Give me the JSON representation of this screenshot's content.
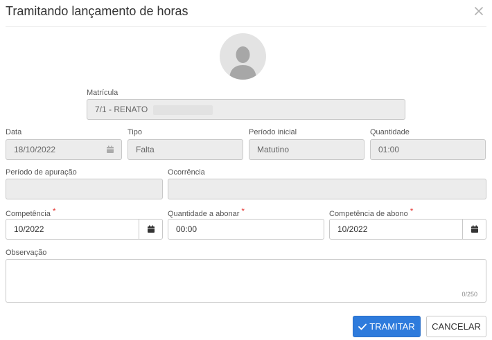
{
  "dialog": {
    "title": "Tramitando lançamento de horas"
  },
  "matricula": {
    "label": "Matrícula",
    "value": "7/1 - RENATO"
  },
  "data": {
    "label": "Data",
    "value": "18/10/2022"
  },
  "tipo": {
    "label": "Tipo",
    "value": "Falta"
  },
  "periodo_inicial": {
    "label": "Período inicial",
    "value": "Matutino"
  },
  "quantidade": {
    "label": "Quantidade",
    "value": "01:00"
  },
  "periodo_apuracao": {
    "label": "Período de apuração",
    "value": ""
  },
  "ocorrencia": {
    "label": "Ocorrência",
    "value": ""
  },
  "competencia": {
    "label": "Competência",
    "required_mark": "*",
    "value": "10/2022"
  },
  "quantidade_abonar": {
    "label": "Quantidade a abonar",
    "required_mark": "*",
    "value": "00:00"
  },
  "competencia_abono": {
    "label": "Competência de abono",
    "required_mark": "*",
    "value": "10/2022"
  },
  "observacao": {
    "label": "Observação",
    "value": "",
    "counter": "0/250"
  },
  "buttons": {
    "tramitar": "TRAMITAR",
    "cancelar": "CANCELAR"
  },
  "colors": {
    "primary": "#2e7bdc",
    "required": "#e53935",
    "readonly_bg": "#ececec"
  },
  "icons": {
    "close": "close-icon",
    "calendar": "calendar-icon",
    "check": "check-icon",
    "avatar": "user-silhouette-icon"
  }
}
